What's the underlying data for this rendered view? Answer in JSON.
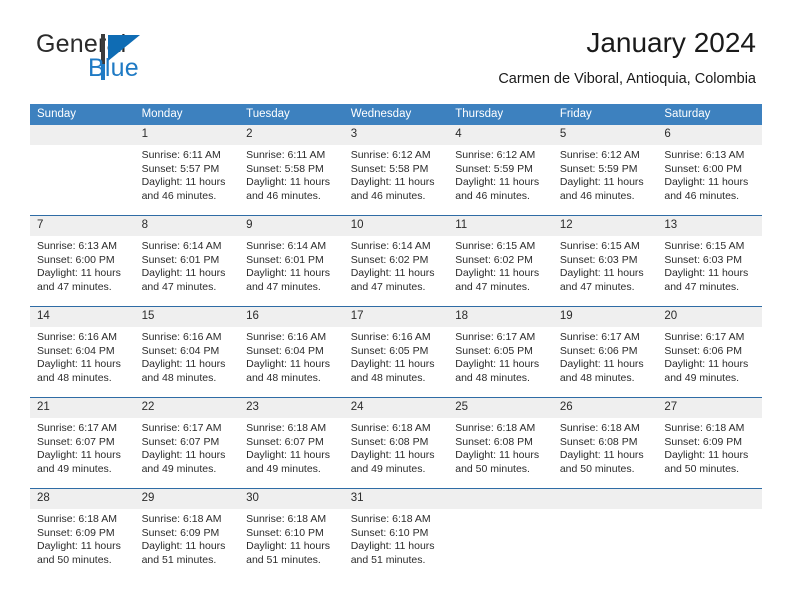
{
  "brand": {
    "name_part1": "General",
    "name_part2": "Blue",
    "logo_icon": "triangle-flag-icon"
  },
  "header": {
    "title": "January 2024",
    "subtitle": "Carmen de Viboral, Antioquia, Colombia"
  },
  "colors": {
    "header_blue": "#3d81bf",
    "row_divider_blue": "#2f6ca5",
    "daynum_band": "#efefef",
    "brand_blue": "#1f7ac4"
  },
  "calendar": {
    "weekday_headers": [
      "Sunday",
      "Monday",
      "Tuesday",
      "Wednesday",
      "Thursday",
      "Friday",
      "Saturday"
    ],
    "weeks": [
      [
        {
          "day": "",
          "empty": true,
          "sunrise": "",
          "sunset": "",
          "daylight_line1": "",
          "daylight_line2": ""
        },
        {
          "day": "1",
          "sunrise": "Sunrise: 6:11 AM",
          "sunset": "Sunset: 5:57 PM",
          "daylight_line1": "Daylight: 11 hours",
          "daylight_line2": "and 46 minutes."
        },
        {
          "day": "2",
          "sunrise": "Sunrise: 6:11 AM",
          "sunset": "Sunset: 5:58 PM",
          "daylight_line1": "Daylight: 11 hours",
          "daylight_line2": "and 46 minutes."
        },
        {
          "day": "3",
          "sunrise": "Sunrise: 6:12 AM",
          "sunset": "Sunset: 5:58 PM",
          "daylight_line1": "Daylight: 11 hours",
          "daylight_line2": "and 46 minutes."
        },
        {
          "day": "4",
          "sunrise": "Sunrise: 6:12 AM",
          "sunset": "Sunset: 5:59 PM",
          "daylight_line1": "Daylight: 11 hours",
          "daylight_line2": "and 46 minutes."
        },
        {
          "day": "5",
          "sunrise": "Sunrise: 6:12 AM",
          "sunset": "Sunset: 5:59 PM",
          "daylight_line1": "Daylight: 11 hours",
          "daylight_line2": "and 46 minutes."
        },
        {
          "day": "6",
          "sunrise": "Sunrise: 6:13 AM",
          "sunset": "Sunset: 6:00 PM",
          "daylight_line1": "Daylight: 11 hours",
          "daylight_line2": "and 46 minutes."
        }
      ],
      [
        {
          "day": "7",
          "sunrise": "Sunrise: 6:13 AM",
          "sunset": "Sunset: 6:00 PM",
          "daylight_line1": "Daylight: 11 hours",
          "daylight_line2": "and 47 minutes."
        },
        {
          "day": "8",
          "sunrise": "Sunrise: 6:14 AM",
          "sunset": "Sunset: 6:01 PM",
          "daylight_line1": "Daylight: 11 hours",
          "daylight_line2": "and 47 minutes."
        },
        {
          "day": "9",
          "sunrise": "Sunrise: 6:14 AM",
          "sunset": "Sunset: 6:01 PM",
          "daylight_line1": "Daylight: 11 hours",
          "daylight_line2": "and 47 minutes."
        },
        {
          "day": "10",
          "sunrise": "Sunrise: 6:14 AM",
          "sunset": "Sunset: 6:02 PM",
          "daylight_line1": "Daylight: 11 hours",
          "daylight_line2": "and 47 minutes."
        },
        {
          "day": "11",
          "sunrise": "Sunrise: 6:15 AM",
          "sunset": "Sunset: 6:02 PM",
          "daylight_line1": "Daylight: 11 hours",
          "daylight_line2": "and 47 minutes."
        },
        {
          "day": "12",
          "sunrise": "Sunrise: 6:15 AM",
          "sunset": "Sunset: 6:03 PM",
          "daylight_line1": "Daylight: 11 hours",
          "daylight_line2": "and 47 minutes."
        },
        {
          "day": "13",
          "sunrise": "Sunrise: 6:15 AM",
          "sunset": "Sunset: 6:03 PM",
          "daylight_line1": "Daylight: 11 hours",
          "daylight_line2": "and 47 minutes."
        }
      ],
      [
        {
          "day": "14",
          "sunrise": "Sunrise: 6:16 AM",
          "sunset": "Sunset: 6:04 PM",
          "daylight_line1": "Daylight: 11 hours",
          "daylight_line2": "and 48 minutes."
        },
        {
          "day": "15",
          "sunrise": "Sunrise: 6:16 AM",
          "sunset": "Sunset: 6:04 PM",
          "daylight_line1": "Daylight: 11 hours",
          "daylight_line2": "and 48 minutes."
        },
        {
          "day": "16",
          "sunrise": "Sunrise: 6:16 AM",
          "sunset": "Sunset: 6:04 PM",
          "daylight_line1": "Daylight: 11 hours",
          "daylight_line2": "and 48 minutes."
        },
        {
          "day": "17",
          "sunrise": "Sunrise: 6:16 AM",
          "sunset": "Sunset: 6:05 PM",
          "daylight_line1": "Daylight: 11 hours",
          "daylight_line2": "and 48 minutes."
        },
        {
          "day": "18",
          "sunrise": "Sunrise: 6:17 AM",
          "sunset": "Sunset: 6:05 PM",
          "daylight_line1": "Daylight: 11 hours",
          "daylight_line2": "and 48 minutes."
        },
        {
          "day": "19",
          "sunrise": "Sunrise: 6:17 AM",
          "sunset": "Sunset: 6:06 PM",
          "daylight_line1": "Daylight: 11 hours",
          "daylight_line2": "and 48 minutes."
        },
        {
          "day": "20",
          "sunrise": "Sunrise: 6:17 AM",
          "sunset": "Sunset: 6:06 PM",
          "daylight_line1": "Daylight: 11 hours",
          "daylight_line2": "and 49 minutes."
        }
      ],
      [
        {
          "day": "21",
          "sunrise": "Sunrise: 6:17 AM",
          "sunset": "Sunset: 6:07 PM",
          "daylight_line1": "Daylight: 11 hours",
          "daylight_line2": "and 49 minutes."
        },
        {
          "day": "22",
          "sunrise": "Sunrise: 6:17 AM",
          "sunset": "Sunset: 6:07 PM",
          "daylight_line1": "Daylight: 11 hours",
          "daylight_line2": "and 49 minutes."
        },
        {
          "day": "23",
          "sunrise": "Sunrise: 6:18 AM",
          "sunset": "Sunset: 6:07 PM",
          "daylight_line1": "Daylight: 11 hours",
          "daylight_line2": "and 49 minutes."
        },
        {
          "day": "24",
          "sunrise": "Sunrise: 6:18 AM",
          "sunset": "Sunset: 6:08 PM",
          "daylight_line1": "Daylight: 11 hours",
          "daylight_line2": "and 49 minutes."
        },
        {
          "day": "25",
          "sunrise": "Sunrise: 6:18 AM",
          "sunset": "Sunset: 6:08 PM",
          "daylight_line1": "Daylight: 11 hours",
          "daylight_line2": "and 50 minutes."
        },
        {
          "day": "26",
          "sunrise": "Sunrise: 6:18 AM",
          "sunset": "Sunset: 6:08 PM",
          "daylight_line1": "Daylight: 11 hours",
          "daylight_line2": "and 50 minutes."
        },
        {
          "day": "27",
          "sunrise": "Sunrise: 6:18 AM",
          "sunset": "Sunset: 6:09 PM",
          "daylight_line1": "Daylight: 11 hours",
          "daylight_line2": "and 50 minutes."
        }
      ],
      [
        {
          "day": "28",
          "sunrise": "Sunrise: 6:18 AM",
          "sunset": "Sunset: 6:09 PM",
          "daylight_line1": "Daylight: 11 hours",
          "daylight_line2": "and 50 minutes."
        },
        {
          "day": "29",
          "sunrise": "Sunrise: 6:18 AM",
          "sunset": "Sunset: 6:09 PM",
          "daylight_line1": "Daylight: 11 hours",
          "daylight_line2": "and 51 minutes."
        },
        {
          "day": "30",
          "sunrise": "Sunrise: 6:18 AM",
          "sunset": "Sunset: 6:10 PM",
          "daylight_line1": "Daylight: 11 hours",
          "daylight_line2": "and 51 minutes."
        },
        {
          "day": "31",
          "sunrise": "Sunrise: 6:18 AM",
          "sunset": "Sunset: 6:10 PM",
          "daylight_line1": "Daylight: 11 hours",
          "daylight_line2": "and 51 minutes."
        },
        {
          "day": "",
          "empty": true,
          "sunrise": "",
          "sunset": "",
          "daylight_line1": "",
          "daylight_line2": ""
        },
        {
          "day": "",
          "empty": true,
          "sunrise": "",
          "sunset": "",
          "daylight_line1": "",
          "daylight_line2": ""
        },
        {
          "day": "",
          "empty": true,
          "sunrise": "",
          "sunset": "",
          "daylight_line1": "",
          "daylight_line2": ""
        }
      ]
    ]
  }
}
